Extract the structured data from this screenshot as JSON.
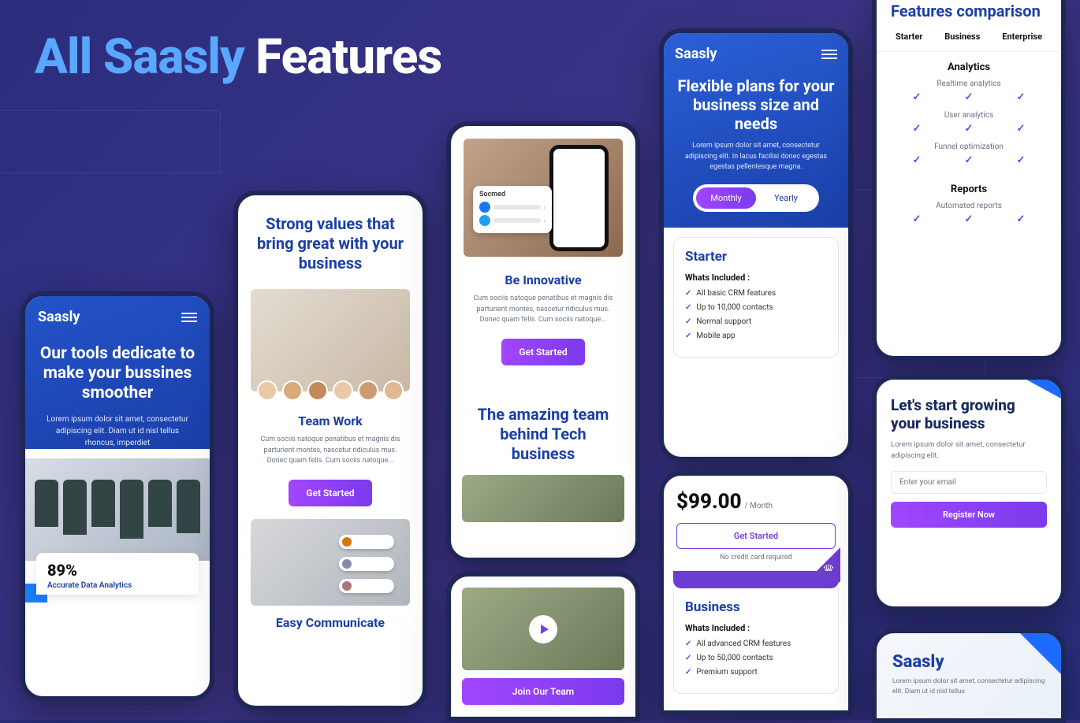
{
  "pageTitle": {
    "part1": "All Saasly",
    "part2": "Features"
  },
  "brand": "Saasly",
  "ph1": {
    "heading": "Our tools dedicate to make your bussines smoother",
    "para": "Lorem ipsum dolor sit amet, consectetur adipiscing elit. Diam ut id nisl tellus rhoncus, imperdiet",
    "statNum": "89%",
    "statLabel": "Accurate Data Analytics"
  },
  "ph2": {
    "heading": "Strong values that bring great with your business",
    "teamTitle": "Team Work",
    "teamPara": "Cum sociis natoque penatibus et magnis dis parturient montes, nascetur ridiculus mus. Donec quam felis. Cum sociis natoque...",
    "btn": "Get Started",
    "commTitle": "Easy Communicate"
  },
  "ph3": {
    "socmed": "Socmed",
    "title": "Be Innovative",
    "para": "Cum sociis natoque penatibus et magnis dis parturient montes, nascetur ridiculus mus. Donec quam felis. Cum sociis natoque...",
    "btn": "Get Started",
    "amazing": "The amazing team behind Tech business",
    "joinBtn": "Join Our Team"
  },
  "ph4": {
    "heading": "Flexible plans for your business size and needs",
    "para": "Lorem ipsum dolor sit amet, consectetur adipiscing elit. In lacus facilisi donec egestas egestas pellentesque magna.",
    "toggle": {
      "monthly": "Monthly",
      "yearly": "Yearly"
    },
    "starter": {
      "name": "Starter",
      "whLabel": "Whats Included :",
      "feats": [
        "All basic CRM features",
        "Up to 10,000 contacts",
        "Normal support",
        "Mobile app"
      ]
    },
    "price": "$99.00",
    "per": "/ Month",
    "getStarted": "Get Started",
    "nocard": "No credit card required",
    "business": {
      "name": "Business",
      "whLabel": "Whats Included :",
      "feats": [
        "All advanced CRM features",
        "Up to 50,000 contacts",
        "Premium support"
      ]
    }
  },
  "ph5": {
    "title": "Features comparison",
    "tiers": [
      "Starter",
      "Business",
      "Enterprise"
    ],
    "analytics": {
      "head": "Analytics",
      "rows": [
        "Realtime analytics",
        "User analytics",
        "Funnel optimization"
      ]
    },
    "reports": {
      "head": "Reports",
      "rows": [
        "Automated reports"
      ]
    }
  },
  "ph6": {
    "heading": "Let's start growing your business",
    "para": "Lorem ipsum dolor sit amet, consectetur adipiscing elit.",
    "placeholder": "Enter your email",
    "btn": "Register Now"
  },
  "ph7": {
    "para": "Lorem ipsum dolor sit amet, consectetur adipiscing elit. Diam ut id nisl tellus"
  }
}
